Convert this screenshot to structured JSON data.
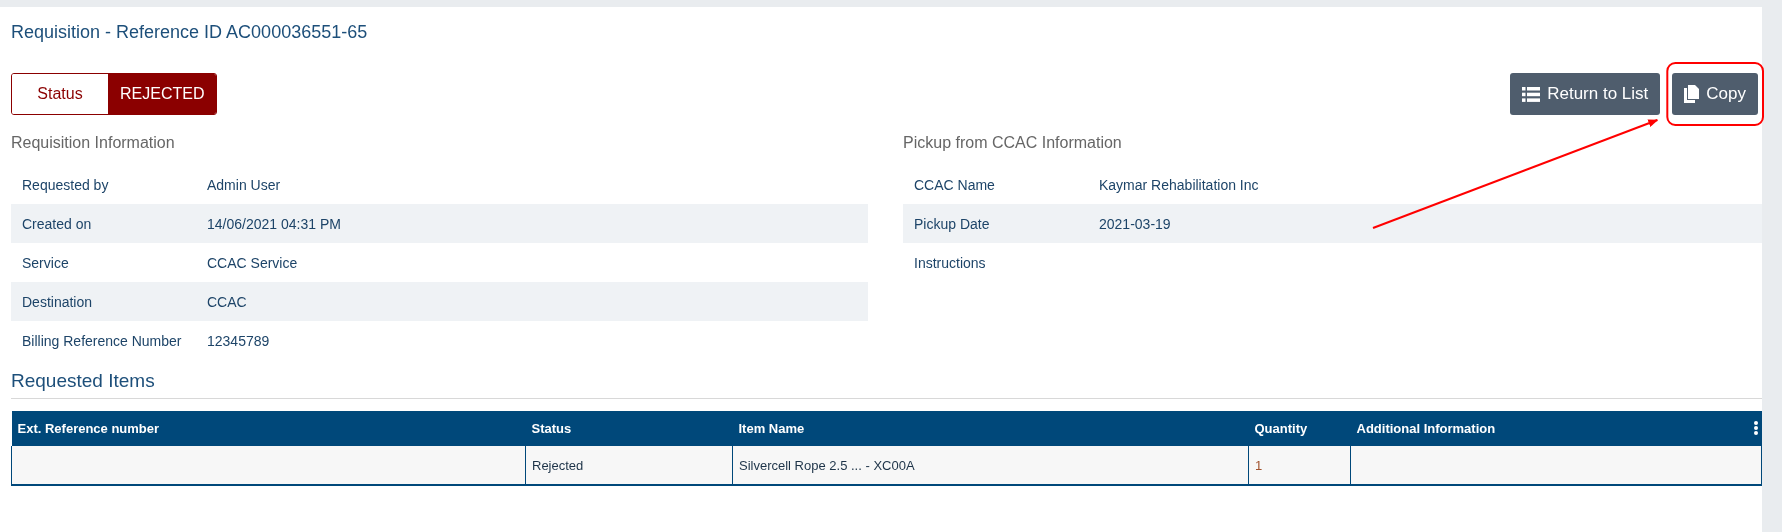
{
  "title": "Requisition - Reference ID AC000036551-65",
  "status": {
    "label": "Status",
    "value": "REJECTED"
  },
  "buttons": [
    {
      "label": "Return to List",
      "kind": "list",
      "highlighted": false
    },
    {
      "label": "Copy",
      "kind": "copy",
      "highlighted": true
    }
  ],
  "sections": [
    {
      "heading": "Requisition Information",
      "rows": [
        {
          "label": "Requested by",
          "value": "Admin User"
        },
        {
          "label": "Created on",
          "value": "14/06/2021 04:31 PM"
        },
        {
          "label": "Service",
          "value": "CCAC Service"
        },
        {
          "label": "Destination",
          "value": "CCAC"
        },
        {
          "label": "Billing Reference Number",
          "value": "12345789"
        }
      ]
    },
    {
      "heading": "Pickup from CCAC Information",
      "rows": [
        {
          "label": "CCAC Name",
          "value": "Kaymar Rehabilitation Inc"
        },
        {
          "label": "Pickup Date",
          "value": "2021-03-19"
        },
        {
          "label": "Instructions"
        }
      ]
    }
  ],
  "items": {
    "heading": "Requested Items",
    "columns": [
      "Ext. Reference number",
      "Status",
      "Item Name",
      "Quantity",
      "Additional Information"
    ],
    "rows": [
      {
        "status": "Rejected",
        "item_name": "Silvercell Rope 2.5 ... - XC00A",
        "quantity": "1"
      }
    ]
  }
}
